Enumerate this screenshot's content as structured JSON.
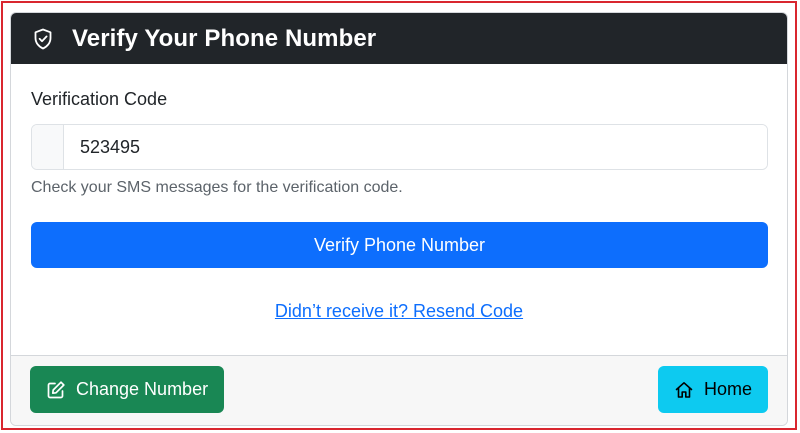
{
  "header": {
    "icon": "shield-check-icon",
    "title": "Verify Your Phone Number"
  },
  "form": {
    "label": "Verification Code",
    "code_value": "523495",
    "help_text": "Check your SMS messages for the verification code.",
    "verify_label": "Verify Phone Number",
    "resend_label": "Didn’t receive it? Resend Code"
  },
  "footer": {
    "change_label": "Change Number",
    "change_icon": "pencil-square-icon",
    "home_label": "Home",
    "home_icon": "house-icon"
  },
  "colors": {
    "header_bg": "#212529",
    "primary": "#0d6efd",
    "success": "#198754",
    "info": "#0dcaf0",
    "frame": "#d9262f"
  }
}
